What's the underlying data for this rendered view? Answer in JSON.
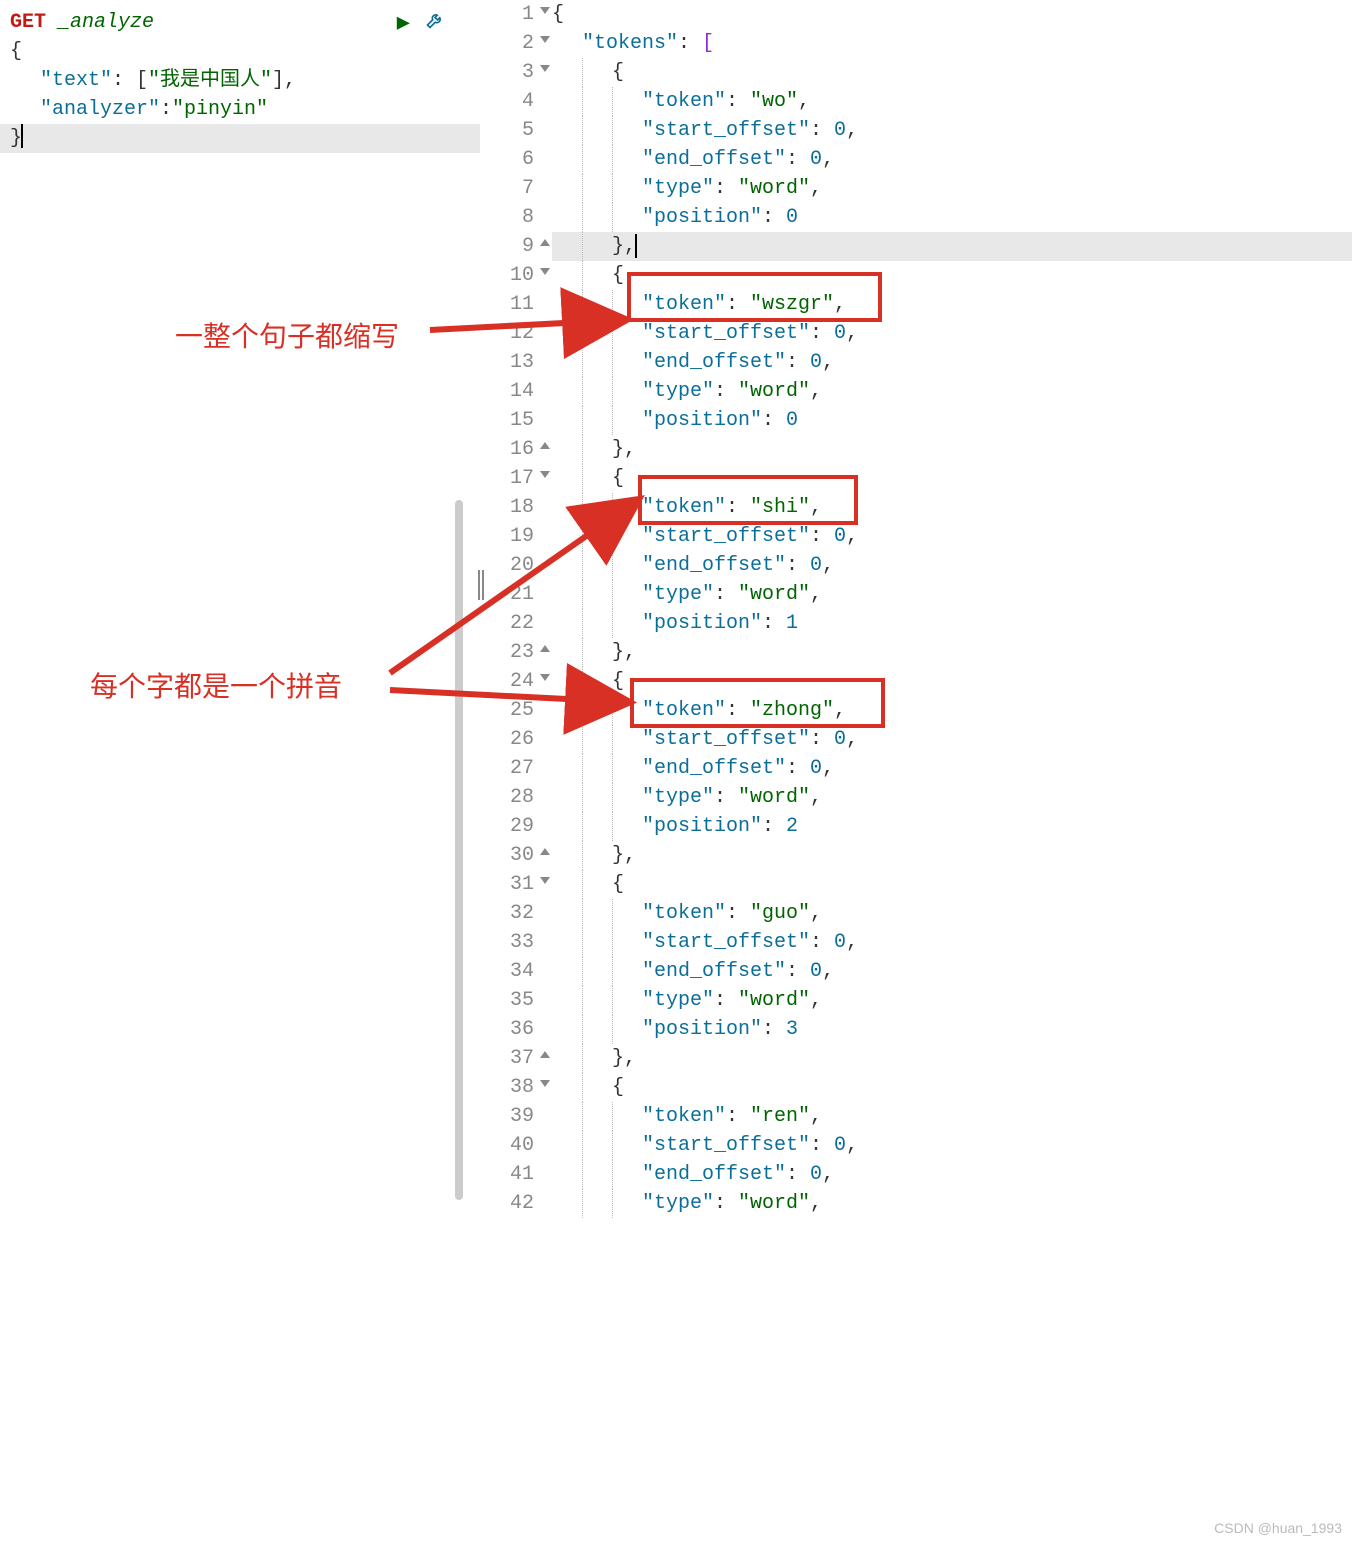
{
  "left": {
    "method": "GET",
    "endpoint": "_analyze",
    "lines": [
      {
        "indent": 0,
        "tokens": [
          {
            "t": "{",
            "c": "punct"
          }
        ]
      },
      {
        "indent": 1,
        "tokens": [
          {
            "t": "\"text\"",
            "c": "key"
          },
          {
            "t": ": [",
            "c": "punct"
          },
          {
            "t": "\"我是中国人\"",
            "c": "value"
          },
          {
            "t": "],",
            "c": "punct"
          }
        ]
      },
      {
        "indent": 1,
        "tokens": [
          {
            "t": "\"analyzer\"",
            "c": "key"
          },
          {
            "t": ": ",
            "c": "punct"
          },
          {
            "t": "\"pinyin\"",
            "c": "value"
          }
        ]
      },
      {
        "indent": 0,
        "tokens": [
          {
            "t": "}",
            "c": "punct"
          }
        ],
        "cursor": true,
        "hl": true
      }
    ]
  },
  "right": {
    "lines": [
      {
        "n": 1,
        "fold": "open",
        "indent": 0,
        "tokens": [
          {
            "t": "{",
            "c": "bracket0"
          }
        ]
      },
      {
        "n": 2,
        "fold": "open",
        "indent": 1,
        "tokens": [
          {
            "t": "\"tokens\"",
            "c": "key"
          },
          {
            "t": ": ",
            "c": "punct"
          },
          {
            "t": "[",
            "c": "bracket1"
          }
        ]
      },
      {
        "n": 3,
        "fold": "open",
        "indent": 2,
        "guides": 1,
        "tokens": [
          {
            "t": "{",
            "c": "bracket0"
          }
        ]
      },
      {
        "n": 4,
        "indent": 3,
        "guides": 2,
        "tokens": [
          {
            "t": "\"token\"",
            "c": "key"
          },
          {
            "t": ": ",
            "c": "punct"
          },
          {
            "t": "\"wo\"",
            "c": "value"
          },
          {
            "t": ",",
            "c": "punct"
          }
        ]
      },
      {
        "n": 5,
        "indent": 3,
        "guides": 2,
        "tokens": [
          {
            "t": "\"start_offset\"",
            "c": "key"
          },
          {
            "t": ": ",
            "c": "punct"
          },
          {
            "t": "0",
            "c": "num"
          },
          {
            "t": ",",
            "c": "punct"
          }
        ]
      },
      {
        "n": 6,
        "indent": 3,
        "guides": 2,
        "tokens": [
          {
            "t": "\"end_offset\"",
            "c": "key"
          },
          {
            "t": ": ",
            "c": "punct"
          },
          {
            "t": "0",
            "c": "num"
          },
          {
            "t": ",",
            "c": "punct"
          }
        ]
      },
      {
        "n": 7,
        "indent": 3,
        "guides": 2,
        "tokens": [
          {
            "t": "\"type\"",
            "c": "key"
          },
          {
            "t": ": ",
            "c": "punct"
          },
          {
            "t": "\"word\"",
            "c": "value"
          },
          {
            "t": ",",
            "c": "punct"
          }
        ]
      },
      {
        "n": 8,
        "indent": 3,
        "guides": 2,
        "tokens": [
          {
            "t": "\"position\"",
            "c": "key"
          },
          {
            "t": ": ",
            "c": "punct"
          },
          {
            "t": "0",
            "c": "num"
          }
        ]
      },
      {
        "n": 9,
        "fold": "close",
        "indent": 2,
        "guides": 1,
        "hl": true,
        "tokens": [
          {
            "t": "}",
            "c": "bracket0"
          },
          {
            "t": ",",
            "c": "punct"
          }
        ],
        "cursor": true
      },
      {
        "n": 10,
        "fold": "open",
        "indent": 2,
        "guides": 1,
        "tokens": [
          {
            "t": "{",
            "c": "bracket0"
          }
        ]
      },
      {
        "n": 11,
        "indent": 3,
        "guides": 2,
        "tokens": [
          {
            "t": "\"token\"",
            "c": "key"
          },
          {
            "t": ": ",
            "c": "punct"
          },
          {
            "t": "\"wszgr\"",
            "c": "value"
          },
          {
            "t": ",",
            "c": "punct"
          }
        ]
      },
      {
        "n": 12,
        "indent": 3,
        "guides": 2,
        "tokens": [
          {
            "t": "\"start_offset\"",
            "c": "key"
          },
          {
            "t": ": ",
            "c": "punct"
          },
          {
            "t": "0",
            "c": "num"
          },
          {
            "t": ",",
            "c": "punct"
          }
        ]
      },
      {
        "n": 13,
        "indent": 3,
        "guides": 2,
        "tokens": [
          {
            "t": "\"end_offset\"",
            "c": "key"
          },
          {
            "t": ": ",
            "c": "punct"
          },
          {
            "t": "0",
            "c": "num"
          },
          {
            "t": ",",
            "c": "punct"
          }
        ]
      },
      {
        "n": 14,
        "indent": 3,
        "guides": 2,
        "tokens": [
          {
            "t": "\"type\"",
            "c": "key"
          },
          {
            "t": ": ",
            "c": "punct"
          },
          {
            "t": "\"word\"",
            "c": "value"
          },
          {
            "t": ",",
            "c": "punct"
          }
        ]
      },
      {
        "n": 15,
        "indent": 3,
        "guides": 2,
        "tokens": [
          {
            "t": "\"position\"",
            "c": "key"
          },
          {
            "t": ": ",
            "c": "punct"
          },
          {
            "t": "0",
            "c": "num"
          }
        ]
      },
      {
        "n": 16,
        "fold": "close",
        "indent": 2,
        "guides": 1,
        "tokens": [
          {
            "t": "}",
            "c": "bracket0"
          },
          {
            "t": ",",
            "c": "punct"
          }
        ]
      },
      {
        "n": 17,
        "fold": "open",
        "indent": 2,
        "guides": 1,
        "tokens": [
          {
            "t": "{",
            "c": "bracket0"
          }
        ]
      },
      {
        "n": 18,
        "indent": 3,
        "guides": 2,
        "tokens": [
          {
            "t": "\"token\"",
            "c": "key"
          },
          {
            "t": ": ",
            "c": "punct"
          },
          {
            "t": "\"shi\"",
            "c": "value"
          },
          {
            "t": ",",
            "c": "punct"
          }
        ]
      },
      {
        "n": 19,
        "indent": 3,
        "guides": 2,
        "tokens": [
          {
            "t": "\"start_offset\"",
            "c": "key"
          },
          {
            "t": ": ",
            "c": "punct"
          },
          {
            "t": "0",
            "c": "num"
          },
          {
            "t": ",",
            "c": "punct"
          }
        ]
      },
      {
        "n": 20,
        "indent": 3,
        "guides": 2,
        "tokens": [
          {
            "t": "\"end_offset\"",
            "c": "key"
          },
          {
            "t": ": ",
            "c": "punct"
          },
          {
            "t": "0",
            "c": "num"
          },
          {
            "t": ",",
            "c": "punct"
          }
        ]
      },
      {
        "n": 21,
        "indent": 3,
        "guides": 2,
        "tokens": [
          {
            "t": "\"type\"",
            "c": "key"
          },
          {
            "t": ": ",
            "c": "punct"
          },
          {
            "t": "\"word\"",
            "c": "value"
          },
          {
            "t": ",",
            "c": "punct"
          }
        ]
      },
      {
        "n": 22,
        "indent": 3,
        "guides": 2,
        "tokens": [
          {
            "t": "\"position\"",
            "c": "key"
          },
          {
            "t": ": ",
            "c": "punct"
          },
          {
            "t": "1",
            "c": "num"
          }
        ]
      },
      {
        "n": 23,
        "fold": "close",
        "indent": 2,
        "guides": 1,
        "tokens": [
          {
            "t": "}",
            "c": "bracket0"
          },
          {
            "t": ",",
            "c": "punct"
          }
        ]
      },
      {
        "n": 24,
        "fold": "open",
        "indent": 2,
        "guides": 1,
        "tokens": [
          {
            "t": "{",
            "c": "bracket0"
          }
        ]
      },
      {
        "n": 25,
        "indent": 3,
        "guides": 2,
        "tokens": [
          {
            "t": "\"token\"",
            "c": "key"
          },
          {
            "t": ": ",
            "c": "punct"
          },
          {
            "t": "\"zhong\"",
            "c": "value"
          },
          {
            "t": ",",
            "c": "punct"
          }
        ]
      },
      {
        "n": 26,
        "indent": 3,
        "guides": 2,
        "tokens": [
          {
            "t": "\"start_offset\"",
            "c": "key"
          },
          {
            "t": ": ",
            "c": "punct"
          },
          {
            "t": "0",
            "c": "num"
          },
          {
            "t": ",",
            "c": "punct"
          }
        ]
      },
      {
        "n": 27,
        "indent": 3,
        "guides": 2,
        "tokens": [
          {
            "t": "\"end_offset\"",
            "c": "key"
          },
          {
            "t": ": ",
            "c": "punct"
          },
          {
            "t": "0",
            "c": "num"
          },
          {
            "t": ",",
            "c": "punct"
          }
        ]
      },
      {
        "n": 28,
        "indent": 3,
        "guides": 2,
        "tokens": [
          {
            "t": "\"type\"",
            "c": "key"
          },
          {
            "t": ": ",
            "c": "punct"
          },
          {
            "t": "\"word\"",
            "c": "value"
          },
          {
            "t": ",",
            "c": "punct"
          }
        ]
      },
      {
        "n": 29,
        "indent": 3,
        "guides": 2,
        "tokens": [
          {
            "t": "\"position\"",
            "c": "key"
          },
          {
            "t": ": ",
            "c": "punct"
          },
          {
            "t": "2",
            "c": "num"
          }
        ]
      },
      {
        "n": 30,
        "fold": "close",
        "indent": 2,
        "guides": 1,
        "tokens": [
          {
            "t": "}",
            "c": "bracket0"
          },
          {
            "t": ",",
            "c": "punct"
          }
        ]
      },
      {
        "n": 31,
        "fold": "open",
        "indent": 2,
        "guides": 1,
        "tokens": [
          {
            "t": "{",
            "c": "bracket0"
          }
        ]
      },
      {
        "n": 32,
        "indent": 3,
        "guides": 2,
        "tokens": [
          {
            "t": "\"token\"",
            "c": "key"
          },
          {
            "t": ": ",
            "c": "punct"
          },
          {
            "t": "\"guo\"",
            "c": "value"
          },
          {
            "t": ",",
            "c": "punct"
          }
        ]
      },
      {
        "n": 33,
        "indent": 3,
        "guides": 2,
        "tokens": [
          {
            "t": "\"start_offset\"",
            "c": "key"
          },
          {
            "t": ": ",
            "c": "punct"
          },
          {
            "t": "0",
            "c": "num"
          },
          {
            "t": ",",
            "c": "punct"
          }
        ]
      },
      {
        "n": 34,
        "indent": 3,
        "guides": 2,
        "tokens": [
          {
            "t": "\"end_offset\"",
            "c": "key"
          },
          {
            "t": ": ",
            "c": "punct"
          },
          {
            "t": "0",
            "c": "num"
          },
          {
            "t": ",",
            "c": "punct"
          }
        ]
      },
      {
        "n": 35,
        "indent": 3,
        "guides": 2,
        "tokens": [
          {
            "t": "\"type\"",
            "c": "key"
          },
          {
            "t": ": ",
            "c": "punct"
          },
          {
            "t": "\"word\"",
            "c": "value"
          },
          {
            "t": ",",
            "c": "punct"
          }
        ]
      },
      {
        "n": 36,
        "indent": 3,
        "guides": 2,
        "tokens": [
          {
            "t": "\"position\"",
            "c": "key"
          },
          {
            "t": ": ",
            "c": "punct"
          },
          {
            "t": "3",
            "c": "num"
          }
        ]
      },
      {
        "n": 37,
        "fold": "close",
        "indent": 2,
        "guides": 1,
        "tokens": [
          {
            "t": "}",
            "c": "bracket0"
          },
          {
            "t": ",",
            "c": "punct"
          }
        ]
      },
      {
        "n": 38,
        "fold": "open",
        "indent": 2,
        "guides": 1,
        "tokens": [
          {
            "t": "{",
            "c": "bracket0"
          }
        ]
      },
      {
        "n": 39,
        "indent": 3,
        "guides": 2,
        "tokens": [
          {
            "t": "\"token\"",
            "c": "key"
          },
          {
            "t": ": ",
            "c": "punct"
          },
          {
            "t": "\"ren\"",
            "c": "value"
          },
          {
            "t": ",",
            "c": "punct"
          }
        ]
      },
      {
        "n": 40,
        "indent": 3,
        "guides": 2,
        "tokens": [
          {
            "t": "\"start_offset\"",
            "c": "key"
          },
          {
            "t": ": ",
            "c": "punct"
          },
          {
            "t": "0",
            "c": "num"
          },
          {
            "t": ",",
            "c": "punct"
          }
        ]
      },
      {
        "n": 41,
        "indent": 3,
        "guides": 2,
        "tokens": [
          {
            "t": "\"end_offset\"",
            "c": "key"
          },
          {
            "t": ": ",
            "c": "punct"
          },
          {
            "t": "0",
            "c": "num"
          },
          {
            "t": ",",
            "c": "punct"
          }
        ]
      },
      {
        "n": 42,
        "indent": 3,
        "guides": 2,
        "tokens": [
          {
            "t": "\"type\"",
            "c": "key"
          },
          {
            "t": ": ",
            "c": "punct"
          },
          {
            "t": "\"word\"",
            "c": "value"
          },
          {
            "t": ",",
            "c": "punct"
          }
        ]
      }
    ]
  },
  "annotations": {
    "a1": "一整个句子都缩写",
    "a2": "每个字都是一个拼音"
  },
  "watermark": "CSDN @huan_1993"
}
